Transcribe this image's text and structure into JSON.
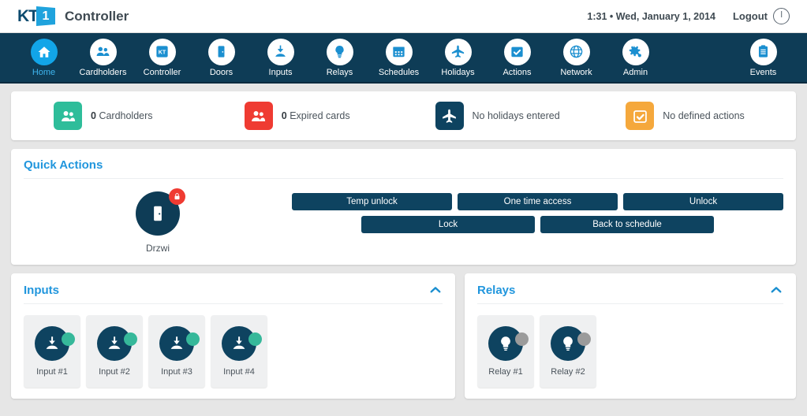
{
  "header": {
    "logo_text": "KT",
    "logo_mark": "1",
    "app_title": "Controller",
    "datetime": "1:31 • Wed, January 1, 2014",
    "logout_label": "Logout",
    "power_icon": "power-icon"
  },
  "nav": {
    "items": [
      {
        "label": "Home",
        "icon": "home-icon",
        "active": true
      },
      {
        "label": "Cardholders",
        "icon": "people-icon",
        "active": false
      },
      {
        "label": "Controller",
        "icon": "kt-badge-icon",
        "active": false
      },
      {
        "label": "Doors",
        "icon": "door-icon",
        "active": false
      },
      {
        "label": "Inputs",
        "icon": "input-icon",
        "active": false
      },
      {
        "label": "Relays",
        "icon": "lightbulb-icon",
        "active": false
      },
      {
        "label": "Schedules",
        "icon": "calendar-icon",
        "active": false
      },
      {
        "label": "Holidays",
        "icon": "airplane-icon",
        "active": false
      },
      {
        "label": "Actions",
        "icon": "calendar-check-icon",
        "active": false
      },
      {
        "label": "Network",
        "icon": "globe-icon",
        "active": false
      },
      {
        "label": "Admin",
        "icon": "gears-icon",
        "active": false
      },
      {
        "label": "Events",
        "icon": "clipboard-icon",
        "active": false
      }
    ]
  },
  "stats": [
    {
      "count": "0",
      "label": "Cardholders",
      "icon": "people-icon",
      "color": "#2ebd9a"
    },
    {
      "count": "0",
      "label": "Expired cards",
      "icon": "people-icon",
      "color": "#ef3b32"
    },
    {
      "count": "",
      "label": "No holidays entered",
      "icon": "airplane-icon",
      "color": "#0e4360"
    },
    {
      "count": "",
      "label": "No defined actions",
      "icon": "calendar-check-icon",
      "color": "#f5a83c"
    }
  ],
  "quick_actions": {
    "title": "Quick Actions",
    "door": {
      "name": "Drzwi",
      "icon": "door-icon",
      "badge": "lock-icon",
      "badge_color": "#ef3b32"
    },
    "buttons_row1": [
      "Temp unlock",
      "One time access",
      "Unlock"
    ],
    "buttons_row2": [
      "Lock",
      "Back to schedule"
    ]
  },
  "inputs_panel": {
    "title": "Inputs",
    "collapse_icon": "chevron-up-icon",
    "tiles": [
      {
        "label": "Input #1",
        "icon": "input-icon",
        "status": "on"
      },
      {
        "label": "Input #2",
        "icon": "input-icon",
        "status": "on"
      },
      {
        "label": "Input #3",
        "icon": "input-icon",
        "status": "on"
      },
      {
        "label": "Input #4",
        "icon": "input-icon",
        "status": "on"
      }
    ]
  },
  "relays_panel": {
    "title": "Relays",
    "collapse_icon": "chevron-up-icon",
    "tiles": [
      {
        "label": "Relay #1",
        "icon": "lightbulb-icon",
        "status": "off"
      },
      {
        "label": "Relay #2",
        "icon": "lightbulb-icon",
        "status": "off"
      }
    ]
  },
  "colors": {
    "navy": "#0e3c56",
    "accent_blue": "#2196dd",
    "active_blue": "#12a5e8",
    "status_on": "#36b89a",
    "status_off": "#9b9b9b",
    "page_bg": "#e6e6e6"
  }
}
